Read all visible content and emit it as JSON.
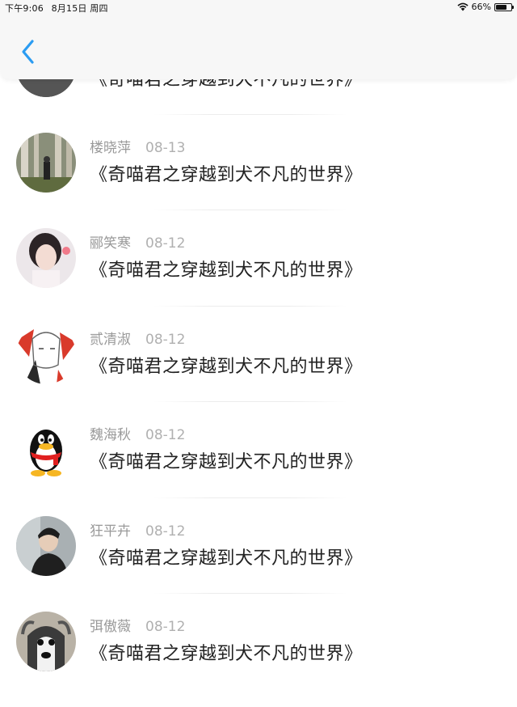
{
  "status_bar": {
    "time": "下午9:06",
    "date": "8月15日 周四",
    "battery": "66%"
  },
  "nav": {
    "back_icon": "chevron-left-icon",
    "accent_color": "#2b9cf2"
  },
  "comments": [
    {
      "name": "",
      "date": "",
      "title": "《奇喵君之穿越到犬不凡的世界》",
      "avatar": "partial"
    },
    {
      "name": "楼晓萍",
      "date": "08-13",
      "title": "《奇喵君之穿越到犬不凡的世界》",
      "avatar": "forest-photo"
    },
    {
      "name": "郦笑寒",
      "date": "08-12",
      "title": "《奇喵君之穿越到犬不凡的世界》",
      "avatar": "girl-photo"
    },
    {
      "name": "贰清淑",
      "date": "08-12",
      "title": "《奇喵君之穿越到犬不凡的世界》",
      "avatar": "sketch-illustration"
    },
    {
      "name": "魏海秋",
      "date": "08-12",
      "title": "《奇喵君之穿越到犬不凡的世界》",
      "avatar": "qq-penguin"
    },
    {
      "name": "狂平卉",
      "date": "08-12",
      "title": "《奇喵君之穿越到犬不凡的世界》",
      "avatar": "man-photo"
    },
    {
      "name": "弭傲薇",
      "date": "08-12",
      "title": "《奇喵君之穿越到犬不凡的世界》",
      "avatar": "husky-photo"
    }
  ]
}
